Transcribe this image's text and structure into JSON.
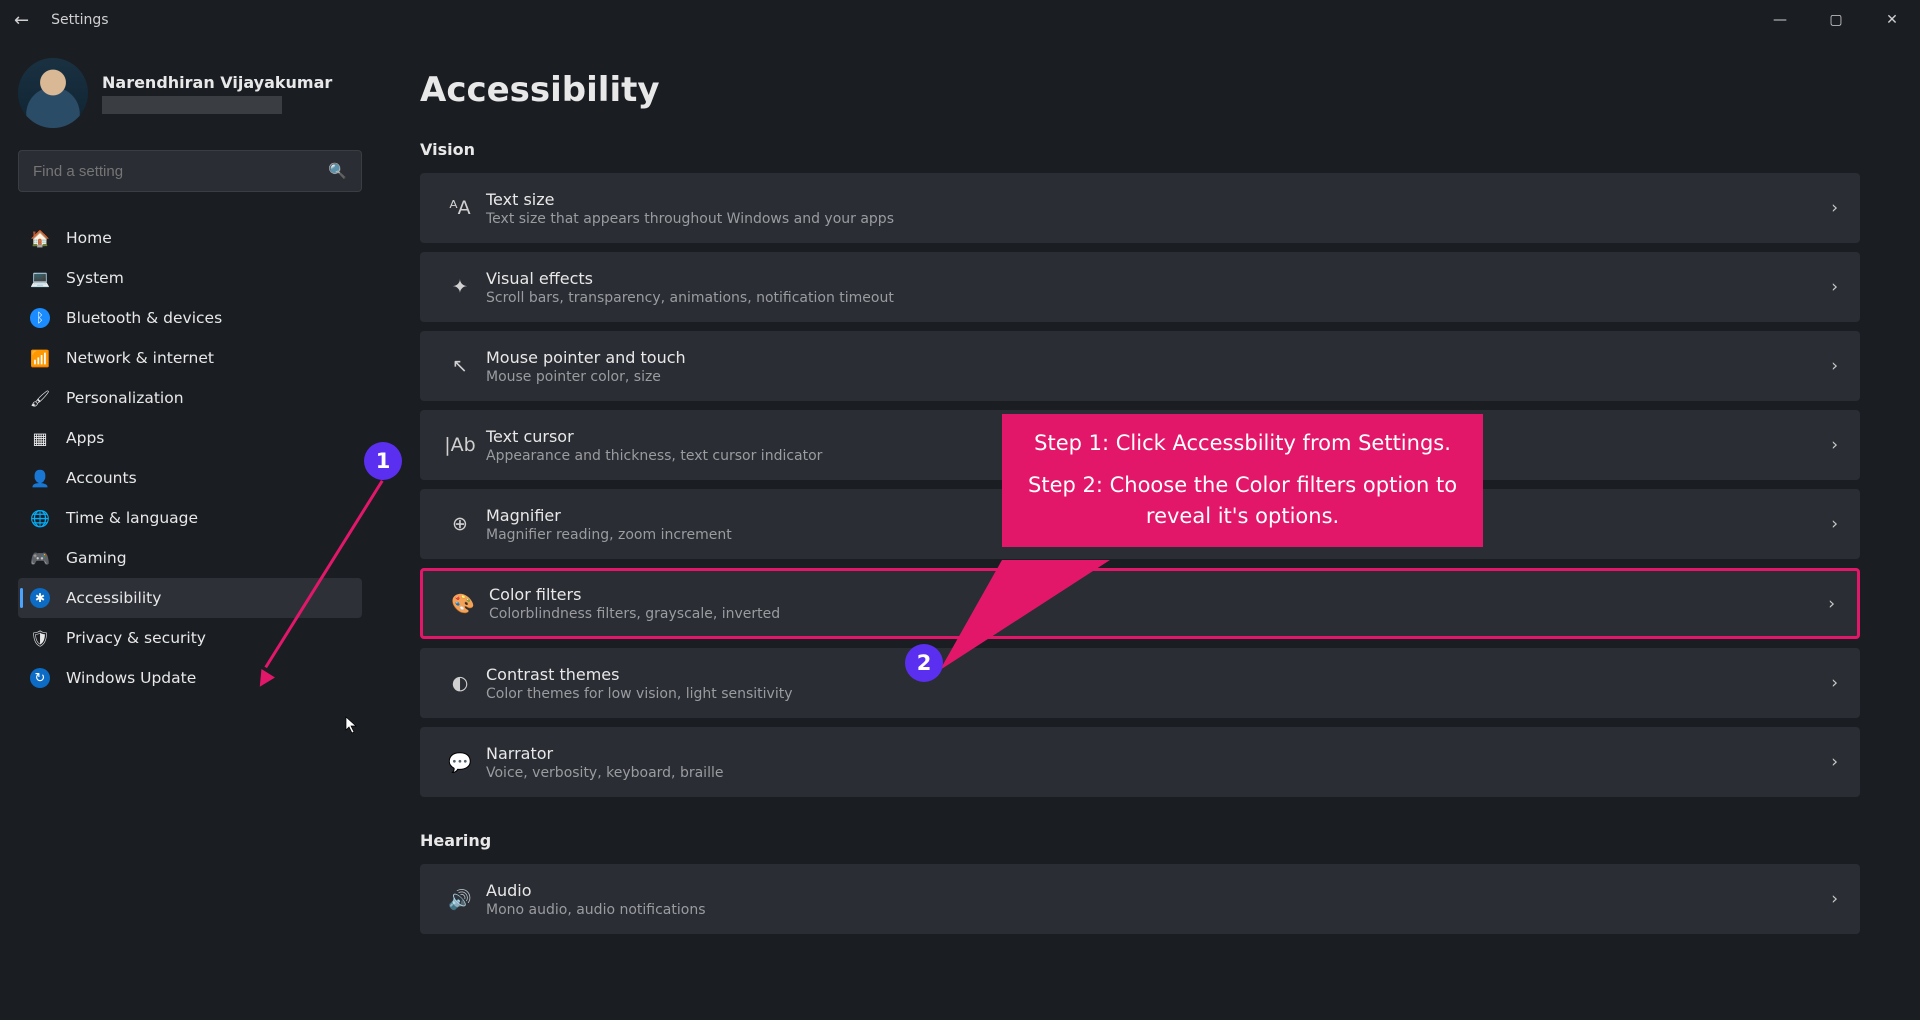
{
  "titlebar": {
    "title": "Settings"
  },
  "user": {
    "name": "Narendhiran Vijayakumar"
  },
  "search": {
    "placeholder": "Find a setting"
  },
  "nav": [
    {
      "label": "Home",
      "icon": "🏠",
      "icon_name": "home-icon"
    },
    {
      "label": "System",
      "icon": "💻",
      "icon_name": "system-icon"
    },
    {
      "label": "Bluetooth & devices",
      "icon": "ᛒ",
      "icon_name": "bluetooth-icon"
    },
    {
      "label": "Network & internet",
      "icon": "📶",
      "icon_name": "wifi-icon"
    },
    {
      "label": "Personalization",
      "icon": "🖌",
      "icon_name": "brush-icon"
    },
    {
      "label": "Apps",
      "icon": "▦",
      "icon_name": "apps-icon"
    },
    {
      "label": "Accounts",
      "icon": "👤",
      "icon_name": "account-icon"
    },
    {
      "label": "Time & language",
      "icon": "🌐",
      "icon_name": "globe-icon"
    },
    {
      "label": "Gaming",
      "icon": "🎮",
      "icon_name": "gaming-icon"
    },
    {
      "label": "Accessibility",
      "icon": "✱",
      "icon_name": "accessibility-icon",
      "active": true
    },
    {
      "label": "Privacy & security",
      "icon": "🛡",
      "icon_name": "shield-icon"
    },
    {
      "label": "Windows Update",
      "icon": "↻",
      "icon_name": "update-icon"
    }
  ],
  "page": {
    "title": "Accessibility",
    "sections": [
      {
        "label": "Vision",
        "items": [
          {
            "title": "Text size",
            "desc": "Text size that appears throughout Windows and your apps",
            "icon": "ᴬA",
            "icon_name": "text-size-icon"
          },
          {
            "title": "Visual effects",
            "desc": "Scroll bars, transparency, animations, notification timeout",
            "icon": "✦",
            "icon_name": "sparkle-icon"
          },
          {
            "title": "Mouse pointer and touch",
            "desc": "Mouse pointer color, size",
            "icon": "↖",
            "icon_name": "pointer-icon"
          },
          {
            "title": "Text cursor",
            "desc": "Appearance and thickness, text cursor indicator",
            "icon": "|Ab",
            "icon_name": "cursor-icon"
          },
          {
            "title": "Magnifier",
            "desc": "Magnifier reading, zoom increment",
            "icon": "⊕",
            "icon_name": "magnifier-icon"
          },
          {
            "title": "Color filters",
            "desc": "Colorblindness filters, grayscale, inverted",
            "icon": "🎨",
            "icon_name": "palette-icon",
            "highlighted": true
          },
          {
            "title": "Contrast themes",
            "desc": "Color themes for low vision, light sensitivity",
            "icon": "◐",
            "icon_name": "contrast-icon"
          },
          {
            "title": "Narrator",
            "desc": "Voice, verbosity, keyboard, braille",
            "icon": "💬",
            "icon_name": "narrator-icon"
          }
        ]
      },
      {
        "label": "Hearing",
        "items": [
          {
            "title": "Audio",
            "desc": "Mono audio, audio notifications",
            "icon": "🔊",
            "icon_name": "audio-icon"
          }
        ]
      }
    ]
  },
  "annotations": {
    "marker1": "1",
    "marker2": "2",
    "callout_line1": "Step 1: Click Accessbility from Settings.",
    "callout_line2": "Step 2: Choose the Color filters option to",
    "callout_line3": "reveal it's options."
  }
}
